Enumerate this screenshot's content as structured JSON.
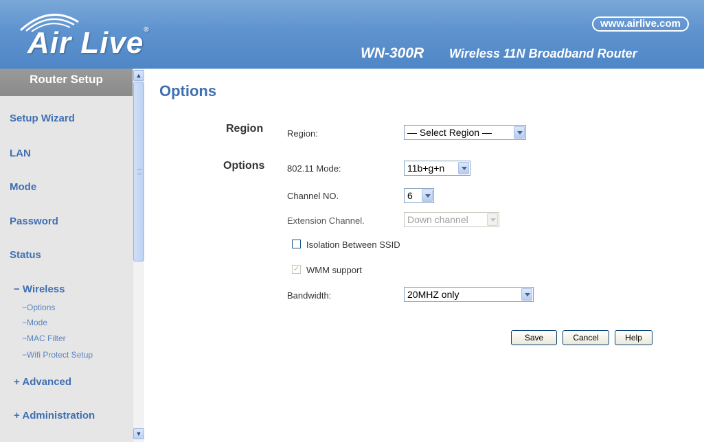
{
  "header": {
    "brand": "Air Live",
    "brand_mark": "®",
    "url": "www.airlive.com",
    "model": "WN-300R",
    "description": "Wireless 11N Broadband Router",
    "colors": {
      "banner": "#5e93cf",
      "text": "#ffffff"
    }
  },
  "sidebar": {
    "title": "Router Setup",
    "items": [
      {
        "label": "Setup Wizard"
      },
      {
        "label": "LAN"
      },
      {
        "label": "Mode"
      },
      {
        "label": "Password"
      },
      {
        "label": "Status"
      }
    ],
    "wireless": {
      "label": "− Wireless",
      "subitems": [
        {
          "label": "−Options"
        },
        {
          "label": "−Mode"
        },
        {
          "label": "−MAC Filter"
        },
        {
          "label": "−Wifi Protect Setup"
        }
      ]
    },
    "advanced": {
      "label": "+ Advanced"
    },
    "administration": {
      "label": "+ Administration"
    },
    "colors": {
      "link": "#3f6fb2",
      "background": "#e6e6e6"
    }
  },
  "main": {
    "title": "Options",
    "region_section": "Region",
    "region_label": "Region:",
    "region_value": "— Select Region —",
    "options_section": "Options",
    "mode_label": "802.11 Mode:",
    "mode_value": "11b+g+n",
    "channel_label": "Channel NO.",
    "channel_value": "6",
    "extension_label": "Extension Channel.",
    "extension_value": "Down channel",
    "isolation_label": "Isolation Between SSID",
    "isolation_checked": false,
    "wmm_label": "WMM support",
    "wmm_checked": true,
    "bandwidth_label": "Bandwidth:",
    "bandwidth_value": "20MHZ only",
    "buttons": {
      "save": "Save",
      "cancel": "Cancel",
      "help": "Help"
    }
  }
}
